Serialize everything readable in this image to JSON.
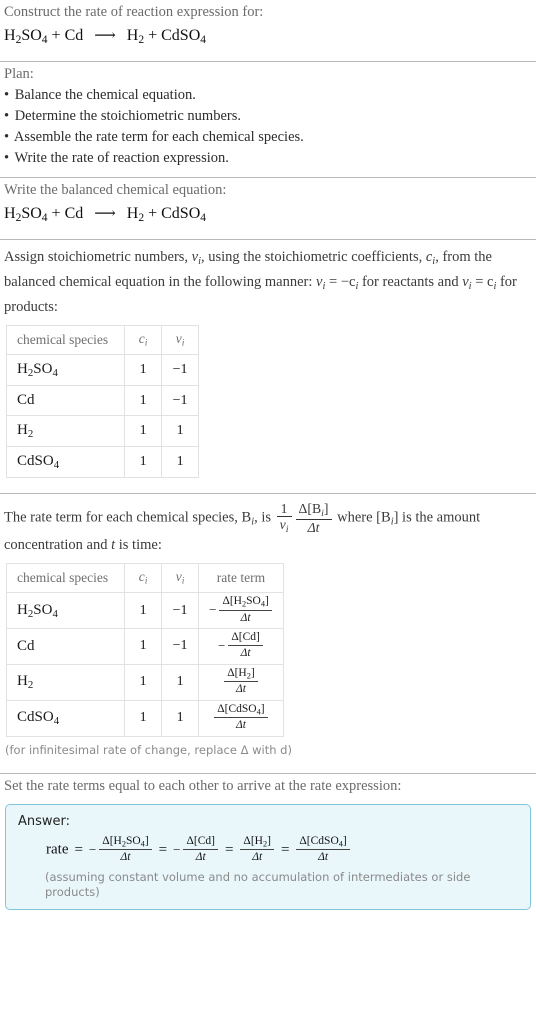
{
  "question": {
    "prompt": "Construct the rate of reaction expression for:",
    "equation": {
      "reactant1": "H2SO4",
      "plus1": "+",
      "reactant2": "Cd",
      "arrow": "⟶",
      "product1": "H2",
      "plus2": "+",
      "product2": "CdSO4"
    }
  },
  "plan": {
    "heading": "Plan:",
    "bullet": "•",
    "steps": [
      "Balance the chemical equation.",
      "Determine the stoichiometric numbers.",
      "Assemble the rate term for each chemical species.",
      "Write the rate of reaction expression."
    ]
  },
  "balanced": {
    "heading": "Write the balanced chemical equation:",
    "equation_text": "H2SO4 + Cd ⟶ H2 + CdSO4"
  },
  "stoich": {
    "intro_part1": "Assign stoichiometric numbers, ",
    "intro_nu": "ν",
    "intro_i": "i",
    "intro_part2": ", using the stoichiometric coefficients, ",
    "intro_c": "c",
    "intro_part3": ", from the balanced chemical equation in the following manner: ",
    "rule_reactants": "= −c",
    "intro_part4": " for reactants and ",
    "rule_products": "= c",
    "intro_part5": " for products:",
    "table": {
      "headers": [
        "chemical species",
        "c",
        "ν"
      ],
      "rows": [
        {
          "species": "H2SO4",
          "c": "1",
          "nu": "−1"
        },
        {
          "species": "Cd",
          "c": "1",
          "nu": "−1"
        },
        {
          "species": "H2",
          "c": "1",
          "nu": "1"
        },
        {
          "species": "CdSO4",
          "c": "1",
          "nu": "1"
        }
      ]
    }
  },
  "rateterm": {
    "intro_part1": "The rate term for each chemical species, B",
    "intro_part2": ", is ",
    "frac_outer_num": "1",
    "frac_outer_den": "ν",
    "frac_inner_num": "Δ[B",
    "frac_inner_num_end": "]",
    "frac_inner_den": "Δt",
    "intro_part3": " where [B",
    "intro_part4": "] is the amount concentration and ",
    "intro_t": "t",
    "intro_part5": " is time:",
    "table": {
      "headers": [
        "chemical species",
        "c",
        "ν",
        "rate term"
      ],
      "rows": [
        {
          "species": "H2SO4",
          "c": "1",
          "nu": "−1",
          "sign": "−",
          "num": "Δ[H2SO4]",
          "den": "Δt"
        },
        {
          "species": "Cd",
          "c": "1",
          "nu": "−1",
          "sign": "−",
          "num": "Δ[Cd]",
          "den": "Δt"
        },
        {
          "species": "H2",
          "c": "1",
          "nu": "1",
          "sign": "",
          "num": "Δ[H2]",
          "den": "Δt"
        },
        {
          "species": "CdSO4",
          "c": "1",
          "nu": "1",
          "sign": "",
          "num": "Δ[CdSO4]",
          "den": "Δt"
        }
      ]
    },
    "footnote": "(for infinitesimal rate of change, replace Δ with d)"
  },
  "result": {
    "heading": "Set the rate terms equal to each other to arrive at the rate expression:",
    "answer_label": "Answer:",
    "rate_word": "rate",
    "equals": "=",
    "terms": [
      {
        "sign": "−",
        "num": "Δ[H2SO4]",
        "den": "Δt"
      },
      {
        "sign": "−",
        "num": "Δ[Cd]",
        "den": "Δt"
      },
      {
        "sign": "",
        "num": "Δ[H2]",
        "den": "Δt"
      },
      {
        "sign": "",
        "num": "Δ[CdSO4]",
        "den": "Δt"
      }
    ],
    "assumption": "(assuming constant volume and no accumulation of intermediates or side products)"
  },
  "colors": {
    "answer_bg": "#e9f7fb",
    "answer_border": "#7fc6d8",
    "divider": "#b9b9b9",
    "table_border": "#e2e2e2",
    "muted_text": "#6b6b6b"
  }
}
